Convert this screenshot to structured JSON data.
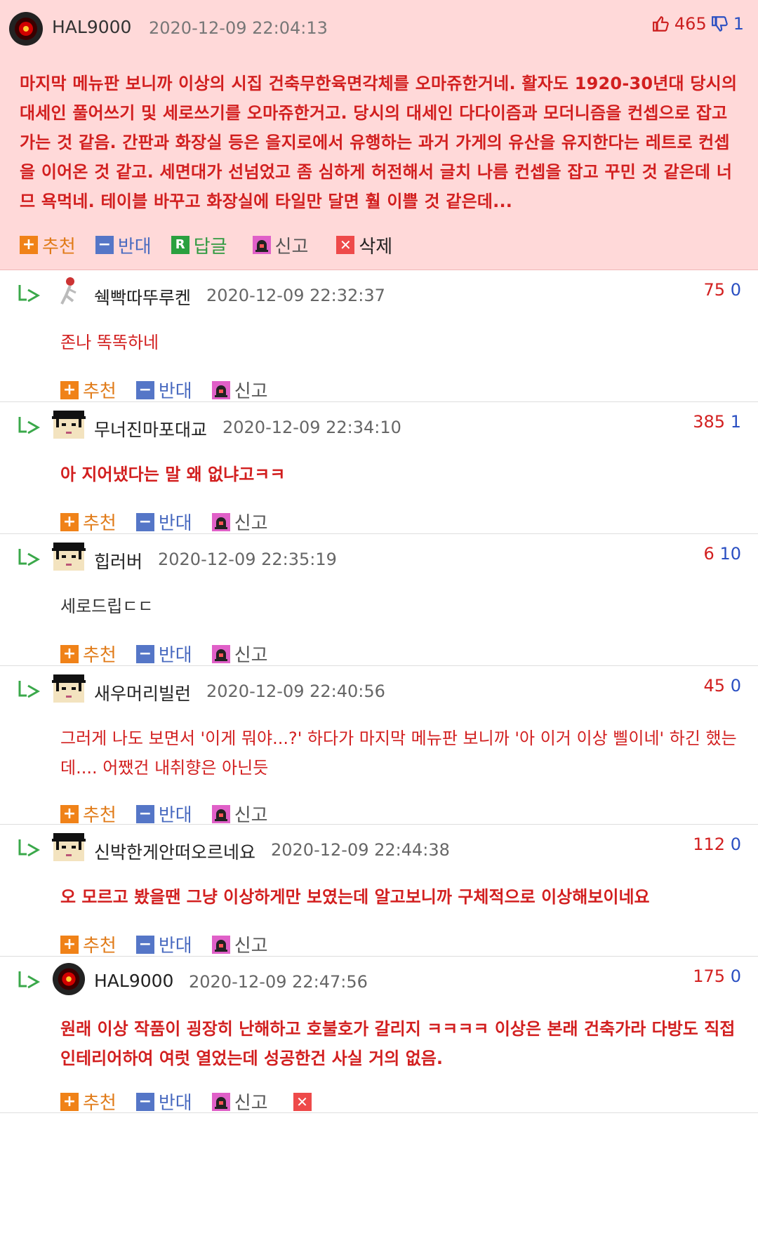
{
  "main_post": {
    "username": "HAL9000",
    "datetime": "2020-12-09 22:04:13",
    "upvotes": "465",
    "downvotes": "1",
    "body": "마지막 메뉴판 보니까 이상의 시집 건축무한육면각체를 오마쥬한거네. 활자도 1920-30년대 당시의 대세인 풀어쓰기 및 세로쓰기를 오마쥬한거고. 당시의 대세인 다다이즘과 모더니즘을 컨셉으로 잡고 가는 것 같음. 간판과 화장실 등은 을지로에서 유행하는 과거 가게의 유산을 유지한다는 레트로 컨셉을 이어온 것 같고. 세면대가 선넘었고 좀 심하게 허전해서 글치 나름 컨셉을 잡고 꾸민 것 같은데 너므 욕먹네. 테이블 바꾸고 화장실에 타일만 달면 훨 이쁠 것 같은데...",
    "actions": {
      "recommend": "추천",
      "oppose": "반대",
      "reply": "답글",
      "report": "신고",
      "delete": "삭제"
    }
  },
  "labels": {
    "recommend": "추천",
    "oppose": "반대",
    "report": "신고"
  },
  "replies": [
    {
      "username": "쉑빡따뚜루켄",
      "datetime": "2020-12-09 22:32:37",
      "upvotes": "75",
      "downvotes": "0",
      "body": "존나 똑똑하네",
      "avatar": "figure-icon",
      "style": "normal"
    },
    {
      "username": "무너진마포대교",
      "datetime": "2020-12-09 22:34:10",
      "upvotes": "385",
      "downvotes": "1",
      "body": "아 지어냈다는 말 왜 없냐고ㅋㅋ",
      "avatar": "pixel-face-icon",
      "style": "bold"
    },
    {
      "username": "힙러버",
      "datetime": "2020-12-09 22:35:19",
      "upvotes": "6",
      "downvotes": "10",
      "body": "세로드립ㄷㄷ",
      "avatar": "pixel-face-icon",
      "style": "plain"
    },
    {
      "username": "새우머리빌런",
      "datetime": "2020-12-09 22:40:56",
      "upvotes": "45",
      "downvotes": "0",
      "body": "그러게 나도 보면서 '이게 뭐야...?' 하다가 마지막 메뉴판 보니까 '아 이거 이상 삘이네' 하긴 했는데.... 어쨌건 내취향은 아닌듯",
      "avatar": "pixel-face-icon",
      "style": "normal"
    },
    {
      "username": "신박한게안떠오르네요",
      "datetime": "2020-12-09 22:44:38",
      "upvotes": "112",
      "downvotes": "0",
      "body": "오 모르고 봤을땐 그냥 이상하게만 보였는데 알고보니까 구체적으로 이상해보이네요",
      "avatar": "pixel-face-icon",
      "style": "bold"
    },
    {
      "username": "HAL9000",
      "datetime": "2020-12-09 22:47:56",
      "upvotes": "175",
      "downvotes": "0",
      "body": "원래 이상 작품이 굉장히 난해하고 호불호가 갈리지 ㅋㅋㅋㅋ 이상은 본래 건축가라 다방도 직접 인테리어하여 여럿 열었는데 성공한건 사실 거의 없음.",
      "avatar": "hal-eye-icon",
      "style": "bold"
    }
  ],
  "colors": {
    "main_bg": "#ffd9d9",
    "text_red": "#d21f1f",
    "recommend": "#e07a17",
    "oppose": "#4a6bc0",
    "reply_green": "#2aa03f",
    "report_pink": "#e060c8"
  }
}
